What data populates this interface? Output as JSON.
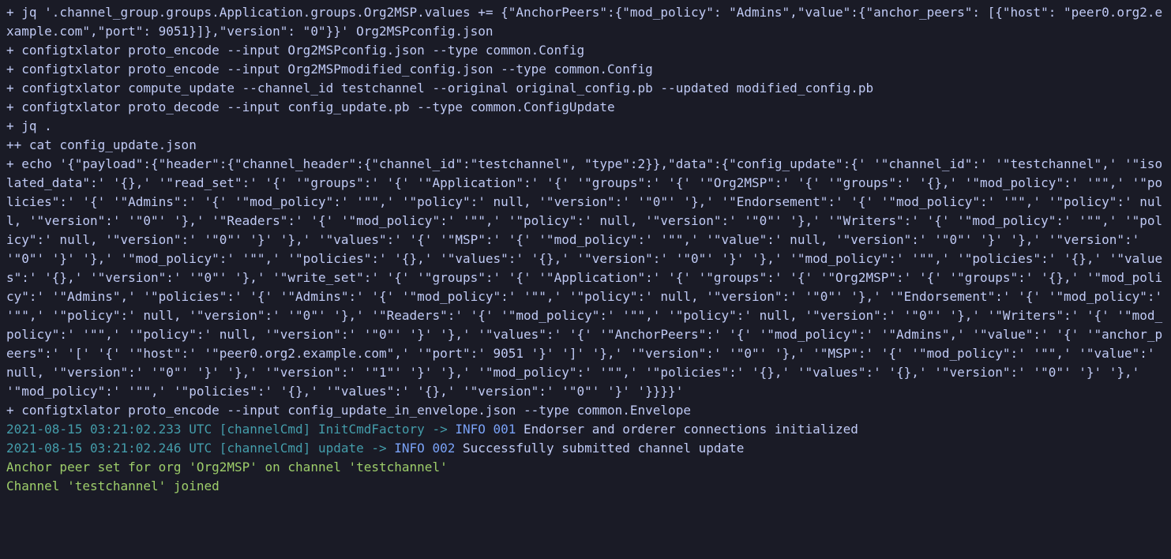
{
  "colors": {
    "default": "#c0caf5",
    "cyan": "#449dab",
    "yellow": "#e0af68",
    "blue": "#7aa2f7",
    "green": "#9ece6a",
    "bg": "#1a1b26"
  },
  "lines": [
    [
      {
        "c": "default",
        "t": "+ jq '.channel_group.groups.Application.groups.Org2MSP.values += {\"AnchorPeers\":{\"mod_policy\": \"Admins\",\"value\":{\"anchor_peers\": [{\"host\": \"peer0.org2.example.com\",\"port\": 9051}]},\"version\": \"0\"}}' Org2MSPconfig.json"
      }
    ],
    [
      {
        "c": "default",
        "t": "+ configtxlator proto_encode --input Org2MSPconfig.json --type common.Config"
      }
    ],
    [
      {
        "c": "default",
        "t": "+ configtxlator proto_encode --input Org2MSPmodified_config.json --type common.Config"
      }
    ],
    [
      {
        "c": "default",
        "t": "+ configtxlator compute_update --channel_id testchannel --original original_config.pb --updated modified_config.pb"
      }
    ],
    [
      {
        "c": "default",
        "t": "+ configtxlator proto_decode --input config_update.pb --type common.ConfigUpdate"
      }
    ],
    [
      {
        "c": "default",
        "t": "+ jq ."
      }
    ],
    [
      {
        "c": "default",
        "t": "++ cat config_update.json"
      }
    ],
    [
      {
        "c": "default",
        "t": "+ echo '{\"payload\":{\"header\":{\"channel_header\":{\"channel_id\":\"testchannel\", \"type\":2}},\"data\":{\"config_update\":{' '\"channel_id\":' '\"testchannel\",' '\"isolated_data\":' '{},' '\"read_set\":' '{' '\"groups\":' '{' '\"Application\":' '{' '\"groups\":' '{' '\"Org2MSP\":' '{' '\"groups\":' '{},' '\"mod_policy\":' '\"\",' '\"policies\":' '{' '\"Admins\":' '{' '\"mod_policy\":' '\"\",' '\"policy\":' null, '\"version\":' '\"0\"' '},' '\"Endorsement\":' '{' '\"mod_policy\":' '\"\",' '\"policy\":' null, '\"version\":' '\"0\"' '},' '\"Readers\":' '{' '\"mod_policy\":' '\"\",' '\"policy\":' null, '\"version\":' '\"0\"' '},' '\"Writers\":' '{' '\"mod_policy\":' '\"\",' '\"policy\":' null, '\"version\":' '\"0\"' '}' '},' '\"values\":' '{' '\"MSP\":' '{' '\"mod_policy\":' '\"\",' '\"value\":' null, '\"version\":' '\"0\"' '}' '},' '\"version\":' '\"0\"' '}' '},' '\"mod_policy\":' '\"\",' '\"policies\":' '{},' '\"values\":' '{},' '\"version\":' '\"0\"' '}' '},' '\"mod_policy\":' '\"\",' '\"policies\":' '{},' '\"values\":' '{},' '\"version\":' '\"0\"' '},' '\"write_set\":' '{' '\"groups\":' '{' '\"Application\":' '{' '\"groups\":' '{' '\"Org2MSP\":' '{' '\"groups\":' '{},' '\"mod_policy\":' '\"Admins\",' '\"policies\":' '{' '\"Admins\":' '{' '\"mod_policy\":' '\"\",' '\"policy\":' null, '\"version\":' '\"0\"' '},' '\"Endorsement\":' '{' '\"mod_policy\":' '\"\",' '\"policy\":' null, '\"version\":' '\"0\"' '},' '\"Readers\":' '{' '\"mod_policy\":' '\"\",' '\"policy\":' null, '\"version\":' '\"0\"' '},' '\"Writers\":' '{' '\"mod_policy\":' '\"\",' '\"policy\":' null, '\"version\":' '\"0\"' '}' '},' '\"values\":' '{' '\"AnchorPeers\":' '{' '\"mod_policy\":' '\"Admins\",' '\"value\":' '{' '\"anchor_peers\":' '[' '{' '\"host\":' '\"peer0.org2.example.com\",' '\"port\":' 9051 '}' ']' '},' '\"version\":' '\"0\"' '},' '\"MSP\":' '{' '\"mod_policy\":' '\"\",' '\"value\":' null, '\"version\":' '\"0\"' '}' '},' '\"version\":' '\"1\"' '}' '},' '\"mod_policy\":' '\"\",' '\"policies\":' '{},' '\"values\":' '{},' '\"version\":' '\"0\"' '}' '},' '\"mod_policy\":' '\"\",' '\"policies\":' '{},' '\"values\":' '{},' '\"version\":' '\"0\"' '}' '}}}}'"
      }
    ],
    [
      {
        "c": "default",
        "t": "+ configtxlator proto_encode --input config_update_in_envelope.json --type common.Envelope"
      }
    ],
    [
      {
        "c": "cyan",
        "t": "2021-08-15 03:21:02.233 UTC [channelCmd] InitCmdFactory -> "
      },
      {
        "c": "blue",
        "t": "INFO 001"
      },
      {
        "c": "default",
        "t": " Endorser and orderer connections initialized"
      }
    ],
    [
      {
        "c": "cyan",
        "t": "2021-08-15 03:21:02.246 UTC [channelCmd] update -> "
      },
      {
        "c": "blue",
        "t": "INFO 002"
      },
      {
        "c": "default",
        "t": " Successfully submitted channel update"
      }
    ],
    [
      {
        "c": "green",
        "t": "Anchor peer set for org 'Org2MSP' on channel 'testchannel'"
      }
    ],
    [
      {
        "c": "green",
        "t": "Channel 'testchannel' joined"
      }
    ]
  ]
}
